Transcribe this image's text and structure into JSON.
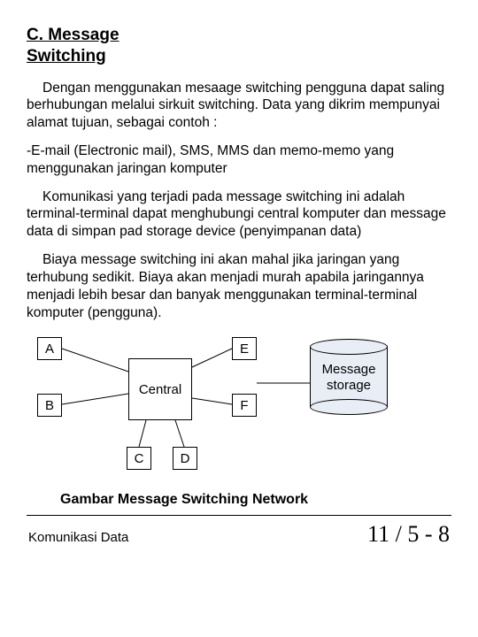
{
  "heading_line1": "C. Message",
  "heading_line2": "Switching",
  "p1": "Dengan menggunakan mesaage switching pengguna dapat saling berhubungan melalui sirkuit switching. Data yang dikrim mempunyai alamat tujuan, sebagai contoh :",
  "p2": "-E-mail (Electronic mail), SMS, MMS dan memo-memo yang menggunakan jaringan komputer",
  "p3": "Komunikasi yang terjadi pada message switching ini adalah terminal-terminal dapat menghubungi central komputer dan message data di simpan pad storage device (penyimpanan data)",
  "p4": "Biaya message switching ini akan mahal jika jaringan yang terhubung sedikit. Biaya akan menjadi murah apabila jaringannya menjadi lebih besar dan banyak menggunakan terminal-terminal komputer (pengguna).",
  "diagram": {
    "A": "A",
    "B": "B",
    "C": "C",
    "D": "D",
    "E": "E",
    "F": "F",
    "central": "Central",
    "storage_l1": "Message",
    "storage_l2": "storage"
  },
  "caption": "Gambar Message Switching Network",
  "footer_left": "Komunikasi Data",
  "footer_right": "11 / 5 - 8"
}
